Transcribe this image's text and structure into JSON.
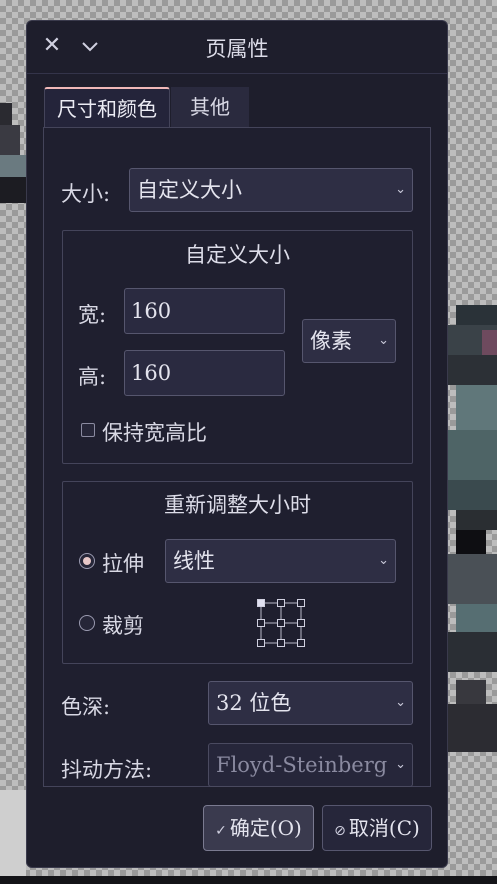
{
  "dialog": {
    "title": "页属性",
    "icons": {
      "close": "close-icon",
      "menu": "chevron-down-icon"
    }
  },
  "tabs": [
    {
      "label": "尺寸和颜色",
      "active": true
    },
    {
      "label": "其他",
      "active": false
    }
  ],
  "size": {
    "label": "大小:",
    "value": "自定义大小"
  },
  "custom_size": {
    "title": "自定义大小",
    "width_label": "宽:",
    "width_value": "160",
    "height_label": "高:",
    "height_value": "160",
    "unit": "像素",
    "keep_ratio_label": "保持宽高比",
    "keep_ratio_checked": false
  },
  "resize": {
    "title": "重新调整大小时",
    "stretch_label": "拉伸",
    "stretch_selected": true,
    "method": "线性",
    "crop_label": "裁剪",
    "crop_selected": false,
    "anchor": "top-left"
  },
  "color_depth": {
    "label": "色深:",
    "value": "32 位色"
  },
  "dither": {
    "label": "抖动方法:",
    "value": "Floyd-Steinberg",
    "disabled": true
  },
  "buttons": {
    "ok": "确定(O)",
    "cancel": "取消(C)"
  },
  "colors": {
    "dialog_bg": "#1e1e2c",
    "accent": "#f0b8b8"
  }
}
